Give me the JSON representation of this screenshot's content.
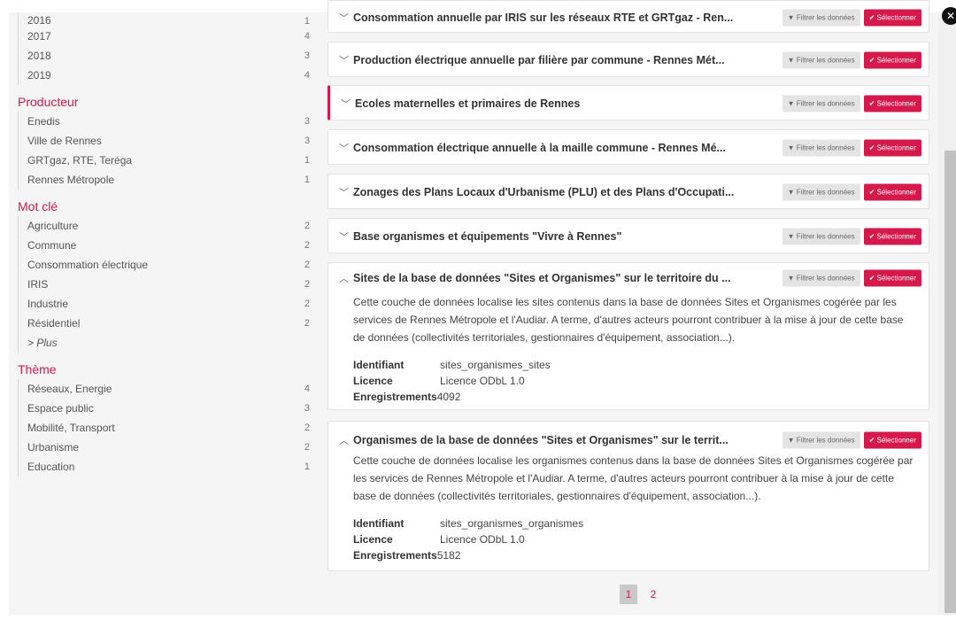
{
  "sidebar": {
    "years": [
      {
        "label": "2016",
        "count": "1"
      },
      {
        "label": "2017",
        "count": "4"
      },
      {
        "label": "2018",
        "count": "3"
      },
      {
        "label": "2019",
        "count": "4"
      }
    ],
    "producteur": {
      "title": "Producteur",
      "items": [
        {
          "label": "Enedis",
          "count": "3"
        },
        {
          "label": "Ville de Rennes",
          "count": "3"
        },
        {
          "label": "GRTgaz, RTE, Teréga",
          "count": "1"
        },
        {
          "label": "Rennes Métropole",
          "count": "1"
        }
      ]
    },
    "motcle": {
      "title": "Mot clé",
      "items": [
        {
          "label": "Agriculture",
          "count": "2"
        },
        {
          "label": "Commune",
          "count": "2"
        },
        {
          "label": "Consommation électrique",
          "count": "2"
        },
        {
          "label": "IRIS",
          "count": "2"
        },
        {
          "label": "Industrie",
          "count": "2"
        },
        {
          "label": "Résidentiel",
          "count": "2"
        }
      ],
      "more": "> Plus"
    },
    "theme": {
      "title": "Thème",
      "items": [
        {
          "label": "Réseaux, Energie",
          "count": "4"
        },
        {
          "label": "Espace public",
          "count": "3"
        },
        {
          "label": "Mobilité, Transport",
          "count": "2"
        },
        {
          "label": "Urbanisme",
          "count": "2"
        },
        {
          "label": "Education",
          "count": "1"
        }
      ]
    }
  },
  "buttons": {
    "filter": "▼ Filtrer les données",
    "select": "✔ Sélectionner"
  },
  "cards": [
    {
      "title": "Consommation annuelle par IRIS sur les réseaux RTE et GRTgaz - Ren..."
    },
    {
      "title": "Production électrique annuelle par filière par commune - Rennes Mét..."
    },
    {
      "title": "Ecoles maternelles et primaires de Rennes"
    },
    {
      "title": "Consommation électrique annuelle à la maille commune - Rennes Mé..."
    },
    {
      "title": "Zonages des Plans Locaux d'Urbanisme (PLU) et des Plans d'Occupati..."
    },
    {
      "title": "Base organismes et équipements \"Vivre à Rennes\""
    },
    {
      "title": "Sites de la base de données \"Sites et Organismes\" sur le territoire du ...",
      "desc": "Cette couche de données localise les sites contenus dans la base de données Sites et Organismes cogérée par les services de Rennes Métropole et l'Audiar. A terme, d'autres acteurs pourront contribuer à la mise à jour de cette base de données (collectivités territoriales, gestionnaires d'équipement, association...).",
      "id_label": "Identifiant",
      "id_value": "sites_organismes_sites",
      "lic_label": "Licence",
      "lic_value": "Licence ODbL 1.0",
      "rec_label": "Enregistrements",
      "rec_value": "4092"
    },
    {
      "title": "Organismes de la base de données \"Sites et Organismes\" sur le territ...",
      "desc": "Cette couche de données localise les organismes contenus dans la base de données Sites et Organismes cogérée par les services de Rennes Métropole et l'Audiar. A terme, d'autres acteurs pourront contribuer à la mise à jour de cette base de données (collectivités territoriales, gestionnaires d'équipement, association...).",
      "id_label": "Identifiant",
      "id_value": "sites_organismes_organismes",
      "lic_label": "Licence",
      "lic_value": "Licence ODbL 1.0",
      "rec_label": "Enregistrements",
      "rec_value": "5182"
    }
  ],
  "pagination": {
    "page1": "1",
    "page2": "2"
  },
  "colors": {
    "accent": "#d51a4b",
    "sidebar_bg": "#f5f5f5"
  }
}
